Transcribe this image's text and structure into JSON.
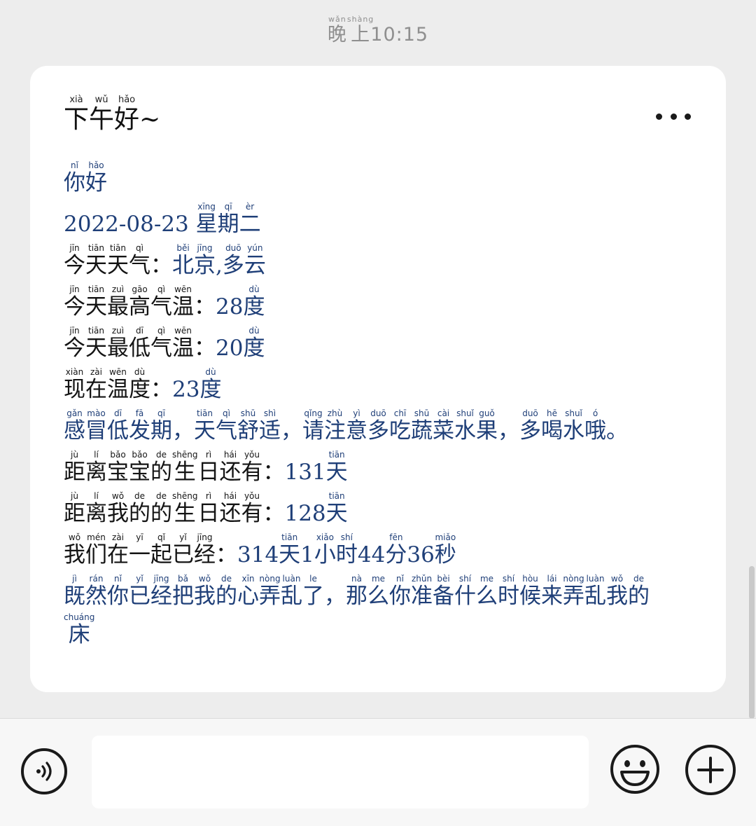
{
  "header": {
    "time_prefix": "晚上",
    "time_prefix_pinyin": [
      "wǎn",
      "shàng"
    ],
    "time_value": "10:15"
  },
  "message": {
    "greeting_chars": [
      "下",
      "午",
      "好"
    ],
    "greeting_pinyin": [
      "xià",
      "wǔ",
      "hǎo"
    ],
    "greeting_suffix": "~",
    "more_icon": "more-horizontal-icon"
  },
  "lines": {
    "hello": {
      "chars": [
        "你",
        "好"
      ],
      "pinyin": [
        "nǐ",
        "hǎo"
      ]
    },
    "date": {
      "text": "2022-08-23 ",
      "chars": [
        "星",
        "期",
        "二"
      ],
      "pinyin": [
        "xīng",
        "qī",
        "èr"
      ]
    },
    "weather": {
      "label_chars": [
        "今",
        "天",
        "天",
        "气"
      ],
      "label_pinyin": [
        "jīn",
        "tiān",
        "tiān",
        "qì"
      ],
      "colon": "：",
      "value_chars": [
        "北",
        "京",
        ",",
        "多",
        "云"
      ],
      "value_pinyin": [
        "běi",
        "jīng",
        "",
        "duō",
        "yún"
      ]
    },
    "high_temp": {
      "label_chars": [
        "今",
        "天",
        "最",
        "高",
        "气",
        "温"
      ],
      "label_pinyin": [
        "jīn",
        "tiān",
        "zuì",
        "gāo",
        "qì",
        "wēn"
      ],
      "colon": "：",
      "value": "28",
      "unit_char": "度",
      "unit_pinyin": "dù"
    },
    "low_temp": {
      "label_chars": [
        "今",
        "天",
        "最",
        "低",
        "气",
        "温"
      ],
      "label_pinyin": [
        "jīn",
        "tiān",
        "zuì",
        "dī",
        "qì",
        "wēn"
      ],
      "colon": "：",
      "value": "20",
      "unit_char": "度",
      "unit_pinyin": "dù"
    },
    "current_temp": {
      "label_chars": [
        "现",
        "在",
        "温",
        "度"
      ],
      "label_pinyin": [
        "xiàn",
        "zài",
        "wēn",
        "dù"
      ],
      "colon": "：",
      "value": "23",
      "unit_char": "度",
      "unit_pinyin": "dù"
    },
    "tip": {
      "chars": [
        "感",
        "冒",
        "低",
        "发",
        "期",
        "，",
        "天",
        "气",
        "舒",
        "适",
        "，",
        "请",
        "注",
        "意",
        "多",
        "吃",
        "蔬",
        "菜",
        "水",
        "果",
        "，",
        "多",
        "喝",
        "水",
        "哦",
        "。"
      ],
      "pinyin": [
        "gǎn",
        "mào",
        "dī",
        "fā",
        "qī",
        "",
        "tiān",
        "qì",
        "shū",
        "shì",
        "",
        "qǐng",
        "zhù",
        "yì",
        "duō",
        "chī",
        "shū",
        "cài",
        "shuǐ",
        "guǒ",
        "",
        "duō",
        "hē",
        "shuǐ",
        "ó",
        ""
      ]
    },
    "baby_birthday": {
      "label_chars": [
        "距",
        "离",
        "宝",
        "宝",
        "的",
        "生",
        "日",
        "还",
        "有"
      ],
      "label_pinyin": [
        "jù",
        "lí",
        "bǎo",
        "bǎo",
        "de",
        "shēng",
        "rì",
        "hái",
        "yǒu"
      ],
      "colon": "：",
      "value": "131",
      "unit_char": "天",
      "unit_pinyin": "tiān"
    },
    "my_birthday": {
      "label_chars": [
        "距",
        "离",
        "我",
        "的",
        "的",
        "生",
        "日",
        "还",
        "有"
      ],
      "label_pinyin": [
        "jù",
        "lí",
        "wǒ",
        "de",
        "de",
        "shēng",
        "rì",
        "hái",
        "yǒu"
      ],
      "colon": "：",
      "value": "128",
      "unit_char": "天",
      "unit_pinyin": "tiān"
    },
    "together": {
      "label_chars": [
        "我",
        "们",
        "在",
        "一",
        "起",
        "已",
        "经"
      ],
      "label_pinyin": [
        "wǒ",
        "mén",
        "zài",
        "yī",
        "qǐ",
        "yǐ",
        "jīng"
      ],
      "colon": "：",
      "days_value": "314",
      "days_char": "天",
      "days_pinyin": "tiān",
      "hours_value": "1",
      "hours_chars": [
        "小",
        "时"
      ],
      "hours_pinyin": [
        "xiǎo",
        "shí"
      ],
      "minutes_value": "44",
      "minutes_char": "分",
      "minutes_pinyin": "fēn",
      "seconds_value": "36",
      "seconds_char": "秒",
      "seconds_pinyin": "miǎo"
    },
    "love_quote": {
      "chars": [
        "既",
        "然",
        "你",
        "已",
        "经",
        "把",
        "我",
        "的",
        "心",
        "弄",
        "乱",
        "了",
        "，",
        "那",
        "么",
        "你",
        "准",
        "备",
        "什",
        "么",
        "时",
        "候",
        "来",
        "弄",
        "乱",
        "我",
        "的",
        "床"
      ],
      "pinyin": [
        "jì",
        "rán",
        "nǐ",
        "yǐ",
        "jīng",
        "bǎ",
        "wǒ",
        "de",
        "xīn",
        "nòng",
        "luàn",
        "le",
        "",
        "nà",
        "me",
        "nǐ",
        "zhǔn",
        "bèi",
        "shí",
        "me",
        "shí",
        "hòu",
        "lái",
        "nòng",
        "luàn",
        "wǒ",
        "de",
        "chuáng"
      ]
    }
  },
  "input_bar": {
    "voice_icon": "voice-icon",
    "input_value": "",
    "emoji_icon": "emoji-icon",
    "plus_icon": "plus-icon"
  },
  "colors": {
    "blue_text": "#1f3f78",
    "dark_text": "#141414",
    "background": "#ededed",
    "card": "#ffffff"
  }
}
